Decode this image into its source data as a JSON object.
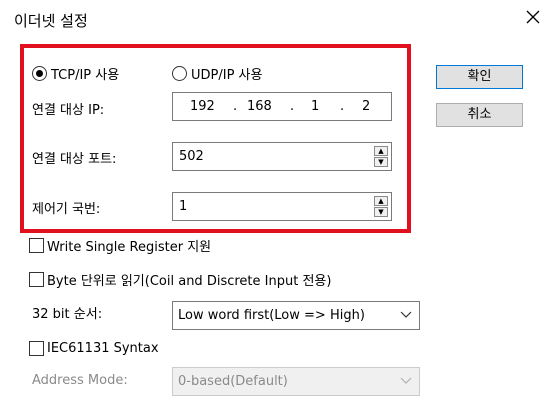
{
  "window": {
    "title": "이더넷 설정",
    "close_icon": "close-icon"
  },
  "protocol": {
    "tcp_label": "TCP/IP 사용",
    "udp_label": "UDP/IP 사용",
    "selected": "tcp"
  },
  "target_ip": {
    "label": "연결 대상 IP:",
    "octets": [
      "192",
      "168",
      "1",
      "2"
    ]
  },
  "target_port": {
    "label": "연결 대상 포트:",
    "value": "502"
  },
  "station": {
    "label": "제어기 국번:",
    "value": "1"
  },
  "buttons": {
    "ok": "확인",
    "cancel": "취소"
  },
  "options": {
    "write_single_register": {
      "label": "Write Single Register 지원",
      "checked": false
    },
    "byte_unit_read": {
      "label": "Byte 단위로 읽기(Coil and Discrete Input 전용)",
      "checked": false
    },
    "iec61131_syntax": {
      "label": "IEC61131 Syntax",
      "checked": false
    }
  },
  "bit32_order": {
    "label": "32 bit 순서:",
    "value": "Low word first(Low => High)"
  },
  "address_mode": {
    "label": "Address Mode:",
    "value": "0-based(Default)",
    "enabled": false
  },
  "colors": {
    "highlight_border": "#e0101e",
    "default_button_border": "#0078d7"
  }
}
